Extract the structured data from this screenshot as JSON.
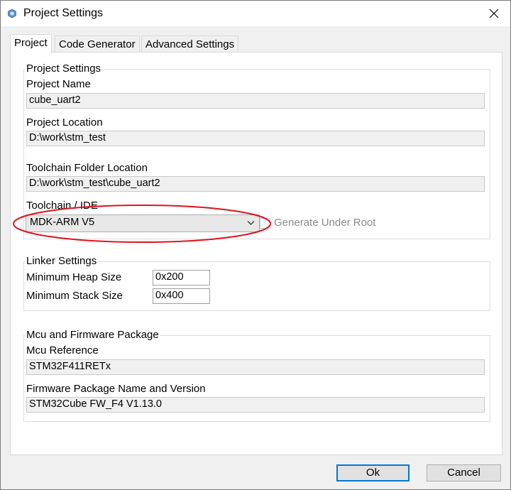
{
  "window": {
    "title": "Project Settings"
  },
  "tabs": [
    {
      "label": "Project"
    },
    {
      "label": "Code Generator"
    },
    {
      "label": "Advanced Settings"
    }
  ],
  "project_settings": {
    "title": "Project Settings",
    "project_name": {
      "label": "Project Name",
      "value": "cube_uart2"
    },
    "project_location": {
      "label": "Project Location",
      "value": "D:\\work\\stm_test"
    },
    "toolchain_folder": {
      "label": "Toolchain Folder Location",
      "value": "D:\\work\\stm_test\\cube_uart2"
    },
    "toolchain_ide": {
      "label": "Toolchain / IDE",
      "selected": "MDK-ARM V5"
    },
    "generate_under_root": {
      "label": "Generate Under Root",
      "checked": false
    }
  },
  "linker_settings": {
    "title": "Linker Settings",
    "min_heap": {
      "label": "Minimum Heap Size",
      "value": "0x200"
    },
    "min_stack": {
      "label": "Minimum Stack Size",
      "value": "0x400"
    }
  },
  "mcu_firmware": {
    "title": "Mcu and Firmware Package",
    "mcu_reference": {
      "label": "Mcu Reference",
      "value": "STM32F411RETx"
    },
    "firmware_package": {
      "label": "Firmware Package Name and Version",
      "value": "STM32Cube FW_F4 V1.13.0"
    }
  },
  "buttons": {
    "ok": "Ok",
    "cancel": "Cancel"
  },
  "colors": {
    "highlight_ellipse": "#e0141e",
    "default_button_border": "#0078d7"
  }
}
